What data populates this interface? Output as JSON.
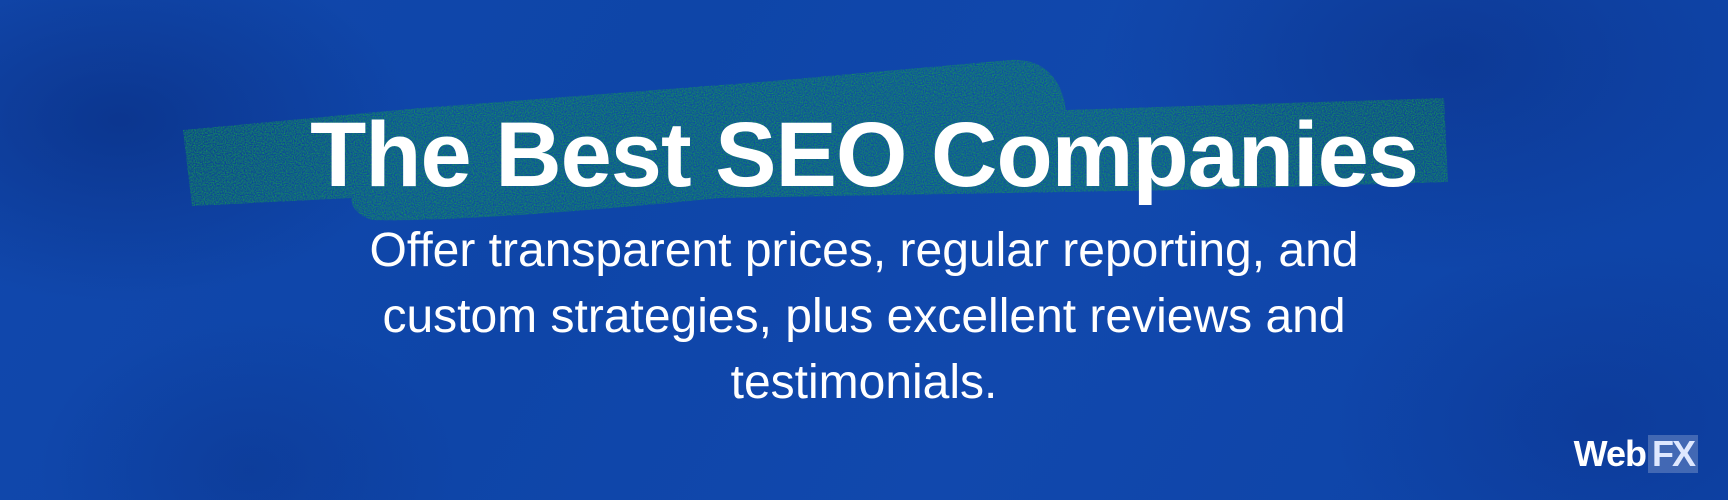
{
  "headline": "The Best SEO Companies",
  "subheadline": "Offer transparent prices, regular reporting, and custom strategies, plus excellent reviews and testimonials.",
  "logo": {
    "web": "Web",
    "fx": "FX"
  },
  "colors": {
    "background": "#1148ad",
    "highlight": "#16a34a",
    "text": "#ffffff"
  }
}
